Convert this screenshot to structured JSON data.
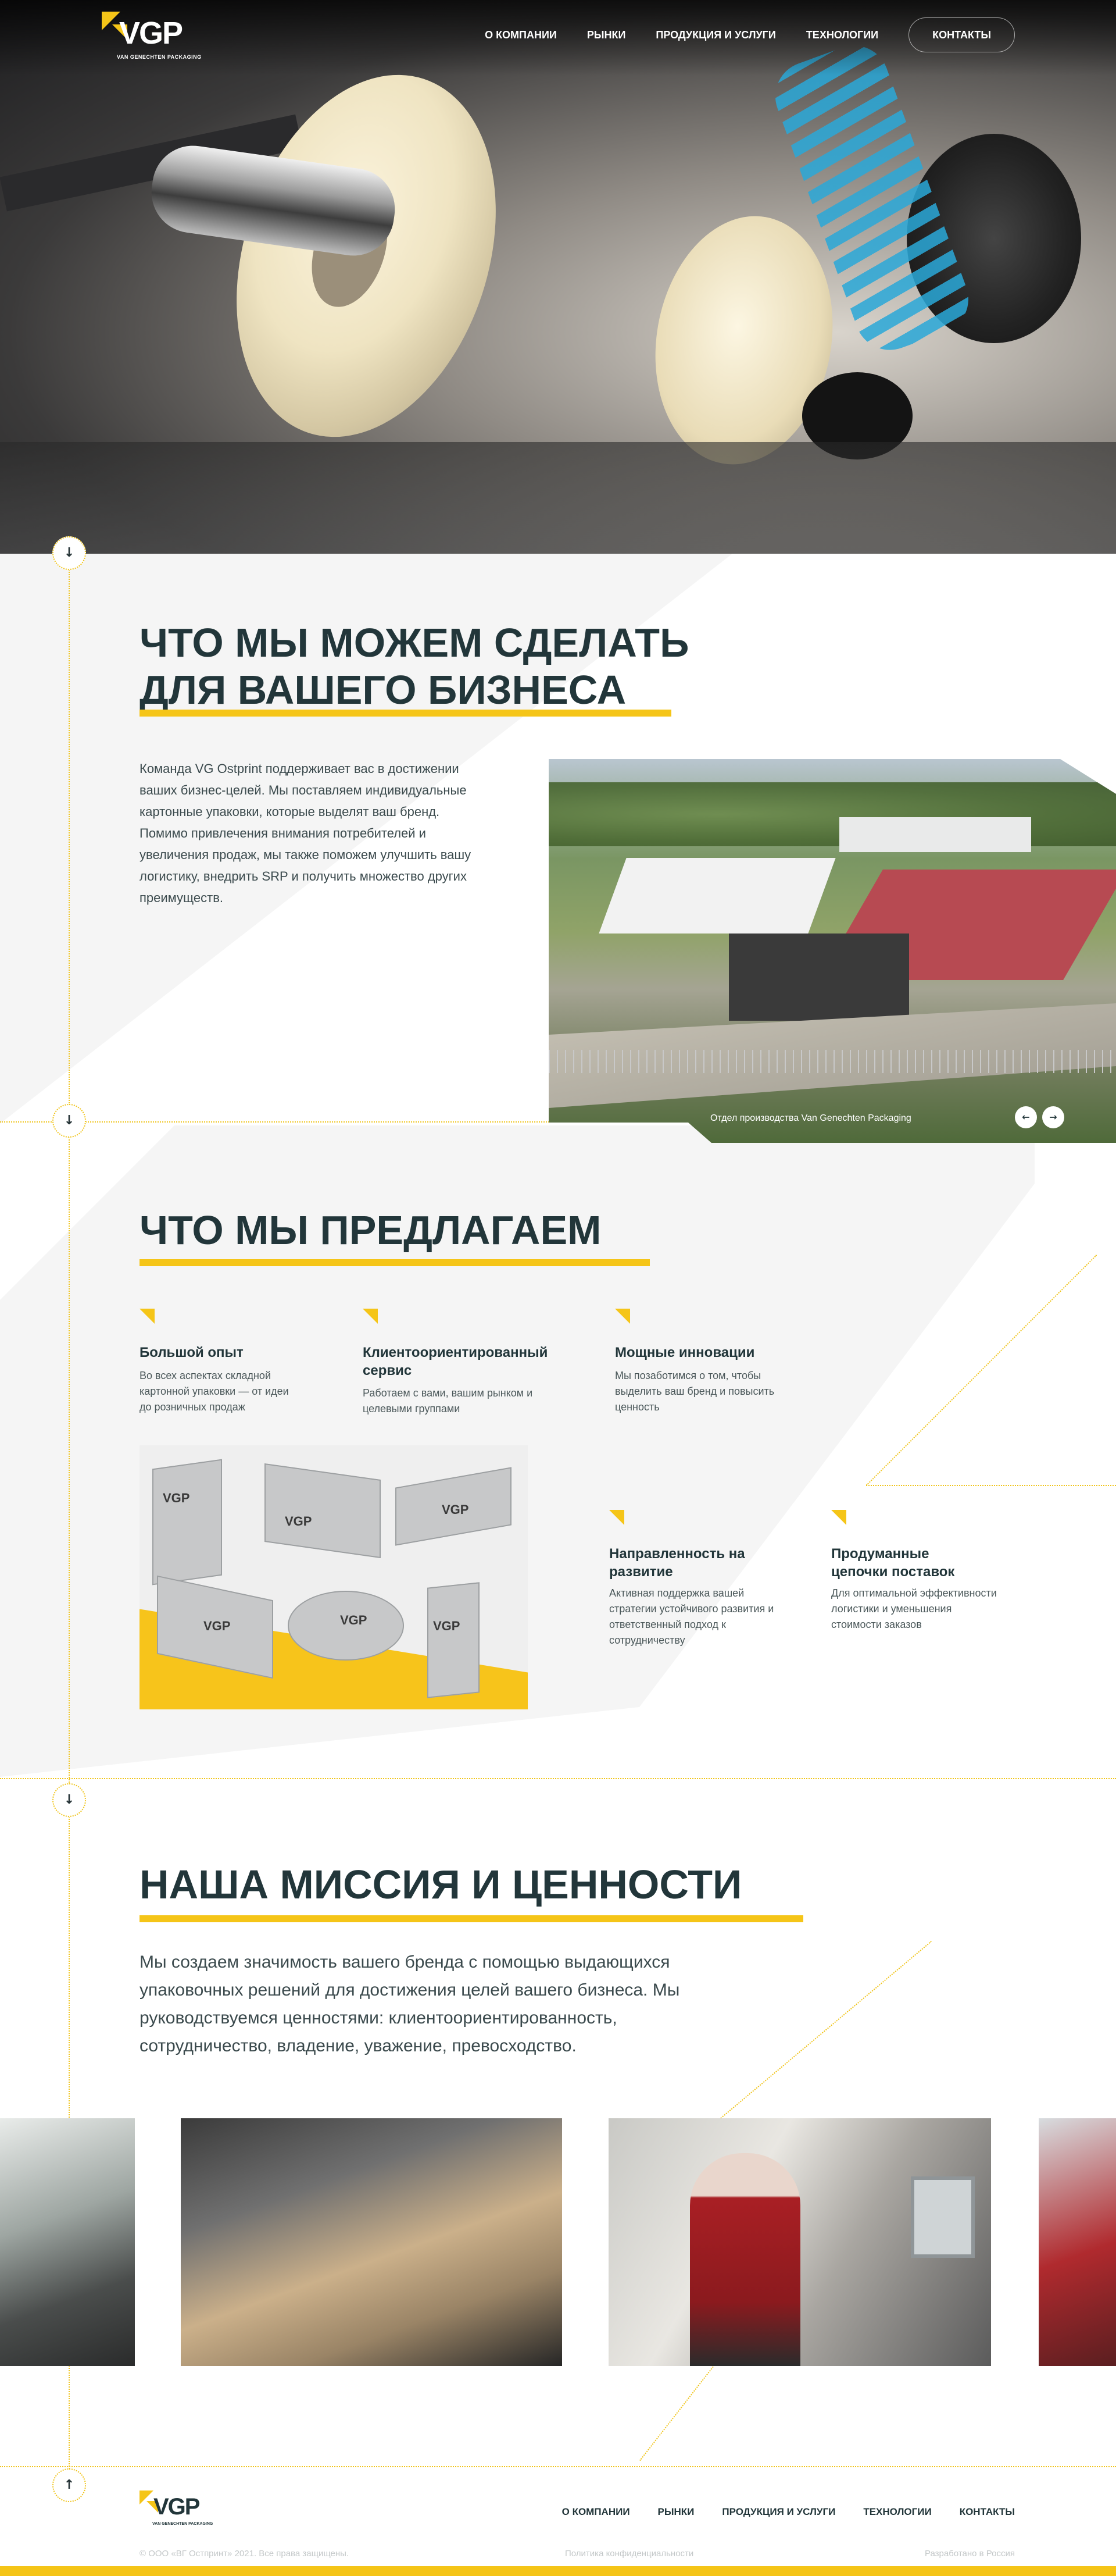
{
  "brand": {
    "logo_text": "VGP",
    "logo_tagline": "VAN GENECHTEN PACKAGING",
    "accent_color": "#f5c518",
    "dark_color": "#22363a"
  },
  "nav": {
    "items": [
      {
        "label": "О компании"
      },
      {
        "label": "Рынки"
      },
      {
        "label": "Продукция и услуги"
      },
      {
        "label": "Технологии"
      }
    ],
    "contact_label": "Контакты"
  },
  "about": {
    "title_line1": "Что мы можем сделать",
    "title_line2": "для вашего бизнеса",
    "text": "Команда VG Ostprint поддерживает вас в достижении ваших бизнес-целей. Мы поставляем индивидуальные картонные упаковки, которые выделят ваш бренд. Помимо привлечения внимания потребителей и увеличения продаж, мы также поможем улучшить вашу логистику, внедрить SRP и получить множество других преимуществ.",
    "slider_caption": "Отдел производства Van Genechten Packaging",
    "prev_icon": "arrow-left-icon",
    "next_icon": "arrow-right-icon"
  },
  "offer": {
    "title": "Что мы предлагаем",
    "features": [
      {
        "title": "Большой опыт",
        "desc": "Во всех аспектах складной картонной упаковки — от идеи до розничных продаж"
      },
      {
        "title": "Клиентоориентированный сервис",
        "desc": "Работаем с вами, вашим рынком и целевыми группами"
      },
      {
        "title": "Мощные инновации",
        "desc": "Мы позаботимся о том, чтобы выделить ваш бренд и повысить ценность"
      },
      {
        "title": "Направленность на развитие",
        "desc": "Активная поддержка вашей стратегии устойчивого развития и ответственный подход к сотрудничеству"
      },
      {
        "title": "Продуманные цепочки поставок",
        "desc": "Для оптимальной эффективности логистики и уменьшения стоимости заказов"
      }
    ],
    "box_label": "VGP"
  },
  "mission": {
    "title": "Наша миссия и ценности",
    "text": "Мы создаем значимость вашего бренда с помощью выдающихся упаковочных решений для достижения целей вашего бизнеса. Мы руководствуемся ценностями: клиентоориентированность, сотрудничество, владение, уважение, превосходство."
  },
  "footer": {
    "nav": [
      {
        "label": "О компании"
      },
      {
        "label": "Рынки"
      },
      {
        "label": "Продукция и услуги"
      },
      {
        "label": "Технологии"
      },
      {
        "label": "Контакты"
      }
    ],
    "copyright": "© ООО «ВГ Остпринт» 2021. Все права защищены.",
    "privacy": "Политика конфиденциальности",
    "developer": "Разработано в Россия"
  },
  "icons": {
    "scroll_down": "arrow-down-icon",
    "scroll_up": "arrow-up-icon"
  }
}
